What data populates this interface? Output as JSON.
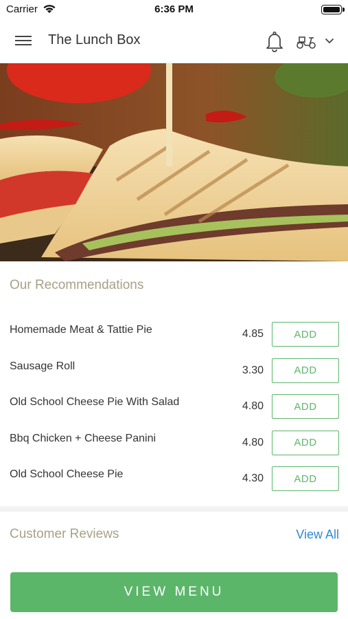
{
  "status_bar": {
    "carrier": "Carrier",
    "time": "6:36 PM",
    "icons": [
      "wifi-icon",
      "battery-icon"
    ]
  },
  "header": {
    "title": "The Lunch Box",
    "icons": [
      "menu-icon",
      "bell-icon",
      "scooter-icon",
      "chevron-down-icon"
    ]
  },
  "hero": {
    "image": "toasted sandwich photo"
  },
  "recommendations": {
    "title": "Our Recommendations",
    "add_label": "ADD",
    "items": [
      {
        "name": "Homemade Meat & Tattie Pie",
        "price": "4.85",
        "add_label": "ADD"
      },
      {
        "name": "Sausage Roll",
        "price": "3.30",
        "add_label": "ADD"
      },
      {
        "name": "Old School Cheese Pie With Salad",
        "price": "4.80",
        "add_label": "ADD"
      },
      {
        "name": "Bbq Chicken + Cheese Panini",
        "price": "4.80",
        "add_label": "ADD"
      },
      {
        "name": "Old School Cheese Pie",
        "price": "4.30",
        "add_label": "ADD"
      }
    ]
  },
  "reviews": {
    "title": "Customer Reviews",
    "view_all": "View All"
  },
  "footer": {
    "button": "VIEW MENU"
  },
  "colors": {
    "accent_green": "#5cb66a",
    "section_title": "#a9a087",
    "link_blue": "#2b8ad6"
  }
}
